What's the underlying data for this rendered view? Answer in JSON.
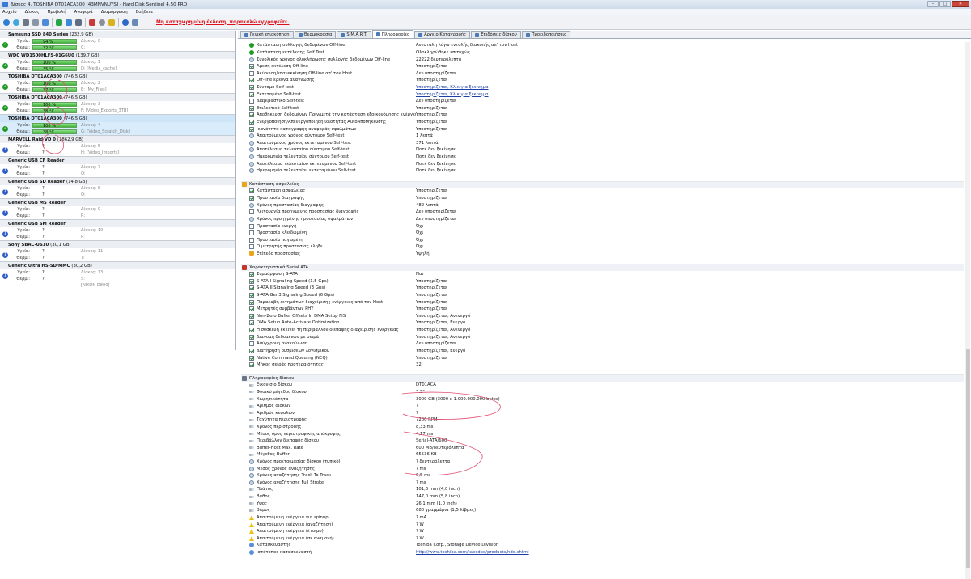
{
  "window": {
    "title": "Δίσκος 4, TOSHIBA DT01ACA300 [43MNVNUYS] - Hard Disk Sentinel 4.50 PRO"
  },
  "menu": [
    "Αρχείο",
    "Δίσκος",
    "Προβολή",
    "Αναφορά",
    "Διαμόρφωση",
    "Βοήθεια"
  ],
  "unregistered_notice": "Μη καταχωρημένη έκδοση, παρακαλώ εγγραφείτε.",
  "disks": [
    {
      "name": "Samsung SSD 840 Series",
      "size": "(232,9 GB)",
      "status": "ok",
      "health_label": "Υγεία:",
      "health": "94 %",
      "health_info": "Δίσκος: 0",
      "temp_label": "Θερμ.:",
      "temp": "32 °C",
      "temp_info": "C:",
      "bar": true
    },
    {
      "name": "WDC WD1500HLFS-01G6U0",
      "size": "(139,7 GB)",
      "status": "ok",
      "health_label": "Υγεία:",
      "health": "100 %",
      "health_info": "Δίσκος: 1",
      "temp_label": "Θερμ.:",
      "temp": "35 °C",
      "temp_info": "D: [Media_cache]",
      "bar": true
    },
    {
      "name": "TOSHIBA DT01ACA300",
      "size": "(746,5 GB)",
      "status": "ok",
      "health_label": "Υγεία:",
      "health": "100 %",
      "health_info": "Δίσκος: 2",
      "temp_label": "Θερμ.:",
      "temp": "37 °C",
      "temp_info": "E: [My_Files]",
      "bar": true
    },
    {
      "name": "TOSHIBA DT01ACA300",
      "size": "(746,5 GB)",
      "status": "ok",
      "health_label": "Υγεία:",
      "health": "100 %",
      "health_info": "Δίσκος: 3",
      "temp_label": "Θερμ.:",
      "temp": "38 °C",
      "temp_info": "F: [Video_Exports_3TB]",
      "bar": true
    },
    {
      "name": "TOSHIBA DT01ACA300",
      "size": "(746,5 GB)",
      "status": "ok",
      "health_label": "Υγεία:",
      "health": "100 %",
      "health_info": "Δίσκος: 4",
      "temp_label": "Θερμ.:",
      "temp": "38 °C",
      "temp_info": "G: [Video_Scratch_Disk]",
      "bar": true,
      "selected": true
    },
    {
      "name": "MARVELL Raid VD 0",
      "size": "(1862,9 GB)",
      "status": "q",
      "health_label": "Υγεία:",
      "health": "?",
      "health_info": "Δίσκος: 5",
      "temp_label": "Θερμ.:",
      "temp": "?",
      "temp_info": "H: [Video_Imports]",
      "bar": false
    },
    {
      "name": "Generic USB CF Reader",
      "size": "",
      "status": "q",
      "health_label": "Υγεία:",
      "health": "?",
      "health_info": "Δίσκος: 7",
      "temp_label": "Θερμ.:",
      "temp": "?",
      "temp_info": "O:",
      "bar": false
    },
    {
      "name": "Generic USB SD Reader",
      "size": "(14,8 GB)",
      "status": "q",
      "health_label": "Υγεία:",
      "health": "?",
      "health_info": "Δίσκος: 8",
      "temp_label": "Θερμ.:",
      "temp": "?",
      "temp_info": "Q:",
      "bar": false
    },
    {
      "name": "Generic USB MS Reader",
      "size": "",
      "status": "q",
      "health_label": "Υγεία:",
      "health": "?",
      "health_info": "Δίσκος: 9",
      "temp_label": "Θερμ.:",
      "temp": "?",
      "temp_info": "R:",
      "bar": false
    },
    {
      "name": "Generic USB SM Reader",
      "size": "",
      "status": "q",
      "health_label": "Υγεία:",
      "health": "?",
      "health_info": "Δίσκος: 10",
      "temp_label": "Θερμ.:",
      "temp": "?",
      "temp_info": "P:",
      "bar": false
    },
    {
      "name": "Sony   SBAC-US10",
      "size": "(30,1 GB)",
      "status": "q",
      "health_label": "Υγεία:",
      "health": "?",
      "health_info": "Δίσκος: 11",
      "temp_label": "Θερμ.:",
      "temp": "?",
      "temp_info": "T:",
      "bar": false
    },
    {
      "name": "Generic Ultra HS-SD/MMC",
      "size": "(30,2 GB)",
      "status": "q",
      "health_label": "Υγεία:",
      "health": "?",
      "health_info": "Δίσκος: 13",
      "temp_label": "Θερμ.:",
      "temp": "?",
      "temp_info": "S:",
      "temp_info2": "[NIKON D800]",
      "bar": false
    }
  ],
  "tabs": [
    {
      "label": "Γενική επισκόπηση",
      "active": false
    },
    {
      "label": "Θερμοκρασία",
      "active": false
    },
    {
      "label": "S.M.A.R.T.",
      "active": false
    },
    {
      "label": "Πληροφορίες",
      "active": true
    },
    {
      "label": "Αρχείο Καταγραφής",
      "active": false
    },
    {
      "label": "Επιδόσεις δίσκου",
      "active": false
    },
    {
      "label": "Προειδοποιήσεις",
      "active": false
    }
  ],
  "sections": [
    {
      "title": "",
      "rows": [
        {
          "icon": "ok",
          "name": "Κατάσταση συλλογής δεδομένων Off-line",
          "value": "Ανεσταλη λόγω εντολής διακοπής απ' τον Host"
        },
        {
          "icon": "ok",
          "name": "Κατάσταση εκτέλεσης Self Test",
          "value": "Ολοκληρώθηκε επιτυχώς"
        },
        {
          "icon": "clk",
          "name": "Συνολικός χρόνος ολοκλήρωσης συλλογής δεδομένων Off-line",
          "value": "22222 δευτερόλεπτα"
        },
        {
          "icon": "cb-on",
          "name": "Αμεση εκτέλεση Off-line",
          "value": "Υποστηρίζεται"
        },
        {
          "icon": "cb",
          "name": "Ακύρωση/επανεκκίνηση Off-line απ' τον Host",
          "value": "Δεν υποστηρίζεται"
        },
        {
          "icon": "cb-on",
          "name": "Off-line έρευνα ανάγνωσης",
          "value": "Υποστηρίζεται"
        },
        {
          "icon": "cb-on",
          "name": "Σύντομο Self-test",
          "value": "Υποστηρίζεται, Κλικ για ξεκίνημα",
          "link": true
        },
        {
          "icon": "cb-on",
          "name": "Εκτεταμένο Self-test",
          "value": "Υποστηρίζεται, Κλικ για ξεκίνημα",
          "link": true
        },
        {
          "icon": "cb",
          "name": "Διαβιβαστικό Self-test",
          "value": "Δεν υποστηρίζεται"
        },
        {
          "icon": "cb-on",
          "name": "Επιλεκτικό Self-test",
          "value": "Υποστηρίζεται"
        },
        {
          "icon": "cb-on",
          "name": "Αποθήκευση δεδομένων Πριν/μετά την κατάσταση εξοικονόμησης ενέργειας",
          "value": "Υποστηρίζεται"
        },
        {
          "icon": "cb-on",
          "name": "Ενεργοποίηση/Απενεργοποίηση ιδιότητας AutoΑποθήκευσης",
          "value": "Υποστηρίζεται"
        },
        {
          "icon": "cb-on",
          "name": "Ικανότητα καταγραφής αναφοράς σφαλμάτων",
          "value": "Υποστηρίζεται"
        },
        {
          "icon": "clk",
          "name": "Απαιτούμενος χρόνος σύντομου Self-test",
          "value": "1 λεπτά"
        },
        {
          "icon": "clk",
          "name": "Απαιτούμενος χρόνος εκτεταμένου Self-test",
          "value": "371 λεπτά"
        },
        {
          "icon": "clk",
          "name": "Αποτέλεσμα τελευταίου σύντομου Self-test",
          "value": "Ποτέ δεν ξεκίνησε"
        },
        {
          "icon": "clk",
          "name": "Ημερομηνία τελευταίου σύντομου Self-test",
          "value": "Ποτέ δεν ξεκίνησε"
        },
        {
          "icon": "clk",
          "name": "Αποτέλεσμα τελευταίου εκτεταμένου Self-test",
          "value": "Ποτέ δεν ξεκίνησε"
        },
        {
          "icon": "clk",
          "name": "Ημερομηνία τελευταίου εκτεταμένου Self-test",
          "value": "Ποτέ δεν ξεκίνησε"
        }
      ]
    },
    {
      "title": "Κατάσταση ασφαλείας",
      "rows": [
        {
          "icon": "cb-on",
          "name": "Κατάσταση ασφαλείας",
          "value": "Υποστηρίζεται"
        },
        {
          "icon": "cb-on",
          "name": "Προστασία διαγραφής",
          "value": "Υποστηρίζεται"
        },
        {
          "icon": "clk",
          "name": "Χρόνος προστασίας διαγραφής",
          "value": "482 λεπτά"
        },
        {
          "icon": "cb",
          "name": "Λειτουργία προηγμένης προστασίας διαγραφής",
          "value": "Δεν υποστηρίζεται"
        },
        {
          "icon": "clk",
          "name": "Χρόνος προηγμένης προστασίας σφαλμάτων",
          "value": "Δεν υποστηρίζεται"
        },
        {
          "icon": "cb",
          "name": "Προστασία ενεργή",
          "value": "Όχι"
        },
        {
          "icon": "cb",
          "name": "Προστασία κλειδωμένη",
          "value": "Όχι"
        },
        {
          "icon": "cb",
          "name": "Προστασία παγωμένη",
          "value": "Όχι"
        },
        {
          "icon": "cb",
          "name": "Ο μετρητής προστασίας έληξε",
          "value": "Όχι"
        },
        {
          "icon": "shld",
          "name": "Επίπεδο προστασίας",
          "value": "Υψηλή"
        }
      ]
    },
    {
      "title": "Χαρακτηριστικά Serial ATA",
      "rows": [
        {
          "icon": "cb-on",
          "name": "Συμμόρφωση S-ATA",
          "value": "Ναι"
        },
        {
          "icon": "cb-on",
          "name": "S-ATA I Signaling Speed (1.5 Gps)",
          "value": "Υποστηρίζεται"
        },
        {
          "icon": "cb-on",
          "name": "S-ATA II Signaling Speed (3 Gps)",
          "value": "Υποστηρίζεται"
        },
        {
          "icon": "cb-on",
          "name": "S-ATA Gen3 Signaling Speed (6 Gps)",
          "value": "Υποστηρίζεται"
        },
        {
          "icon": "cb-on",
          "name": "Παραλαβή αιτημάτων διαχείρισης ενέργειας από τον Host",
          "value": "Υποστηρίζεται"
        },
        {
          "icon": "cb-on",
          "name": "Μετρητές συμβάντων PHY",
          "value": "Υποστηρίζεται"
        },
        {
          "icon": "cb-on",
          "name": "Non-Zero Buffer Offsets In DMA Setup FIS",
          "value": "Υποστηρίζεται, Ανενεργό"
        },
        {
          "icon": "cb-on",
          "name": "DMA Setup Auto-Activate Optimization",
          "value": "Υποστηρίζεται, Ενεργό"
        },
        {
          "icon": "cb-on",
          "name": "Η συσκευή εκκινεί τη περιβάλλον διεπαφής διαχείρισης ενέργειας",
          "value": "Υποστηρίζεται, Ανενεργό"
        },
        {
          "icon": "cb-on",
          "name": "Διανομή δεδομένων με σειρά",
          "value": "Υποστηρίζεται, Ανενεργό"
        },
        {
          "icon": "cb",
          "name": "Ασύγχρονη ανακοίνωση",
          "value": "Δεν υποστηρίζεται"
        },
        {
          "icon": "cb-on",
          "name": "Διατήρηση ρυθμίσεων λογισμικού",
          "value": "Υποστηρίζεται, Ενεργό"
        },
        {
          "icon": "cb-on",
          "name": "Native Command Queuing (NCQ)",
          "value": "Υποστηρίζεται"
        },
        {
          "icon": "cb-on",
          "name": "Μήκος σειράς προτεραιότητας",
          "value": "32"
        }
      ]
    },
    {
      "title": "Πληροφορίες δίσκου",
      "rows": [
        {
          "icon": "arr",
          "name": "Εικονίσιο δίσκου",
          "value": "DT01ACA"
        },
        {
          "icon": "arr",
          "name": "Φυσικό μέγεθος δίσκου",
          "value": "3.5\""
        },
        {
          "icon": "arr",
          "name": "Χωρητικότητα",
          "value": "3000 GB (3000 x 1.000.000.000 bytes)"
        },
        {
          "icon": "arr",
          "name": "Αριθμός δίσκων",
          "value": "?"
        },
        {
          "icon": "arr",
          "name": "Αριθμός κεφαλών",
          "value": "?"
        },
        {
          "icon": "arr",
          "name": "Ταχύτητα περιστροφής",
          "value": "7200 RPM"
        },
        {
          "icon": "arr",
          "name": "Χρόνος περιστροφής",
          "value": "8,33 ms"
        },
        {
          "icon": "arr",
          "name": "Μέσος όρος περιστροφικής απόκρυψης",
          "value": "4,17 ms"
        },
        {
          "icon": "arr",
          "name": "Περιβάλλον διεπαφής δίσκου",
          "value": "Serial-ATA/600"
        },
        {
          "icon": "arr",
          "name": "Buffer-Host Max. Rate",
          "value": "600 MB/δευτερόλεπτα"
        },
        {
          "icon": "arr",
          "name": "Μέγεθος Buffer",
          "value": "65536 KB"
        },
        {
          "icon": "clk",
          "name": "Χρόνος προετοιμασίας δίσκου (τυπικό)",
          "value": "? δευτερόλεπτα"
        },
        {
          "icon": "clk",
          "name": "Μέσος χρόνος αναζήτησης",
          "value": "? ms"
        },
        {
          "icon": "clk",
          "name": "Χρόνος αναζήτησης Track To Track",
          "value": "0,5 ms"
        },
        {
          "icon": "clk",
          "name": "Χρόνος αναζήτησης Full Stroke",
          "value": "? ms"
        },
        {
          "icon": "arr",
          "name": "Πλάτος",
          "value": "101,6 mm (4,0 inch)"
        },
        {
          "icon": "arr",
          "name": "Βάθος",
          "value": "147,0 mm (5,8 inch)"
        },
        {
          "icon": "arr",
          "name": "Υψος",
          "value": "26,1 mm (1,0 inch)"
        },
        {
          "icon": "arr",
          "name": "Βάρος",
          "value": "680 γραμμάρια (1,5 λίβρες)"
        },
        {
          "icon": "warn",
          "name": "Απαιτούμενη ενέργεια για spinup",
          "value": "? mA"
        },
        {
          "icon": "warn",
          "name": "Απαιτούμενη ενέργεια (αναζήτηση)",
          "value": "? W"
        },
        {
          "icon": "warn",
          "name": "Απαιτούμενη ενέργεια (έτοιμο)",
          "value": "? W"
        },
        {
          "icon": "warn",
          "name": "Απαιτούμενη ενέργεια (σε αναμονή)",
          "value": "? W"
        },
        {
          "icon": "inf",
          "name": "Κατασκευαστής",
          "value": "Toshiba Corp., Storage Device Division"
        },
        {
          "icon": "inf",
          "name": "Ιστότοπος κατασκευαστή",
          "value": "http://www.toshiba.com/taecdpd/products/hdd.shtml",
          "link": true
        }
      ]
    }
  ],
  "colors": {
    "annotation": "#e05070",
    "health_bar": "#41b53a",
    "selected": "#d9ecfb",
    "link": "#1d3fa8",
    "notice": "#e0101a"
  }
}
